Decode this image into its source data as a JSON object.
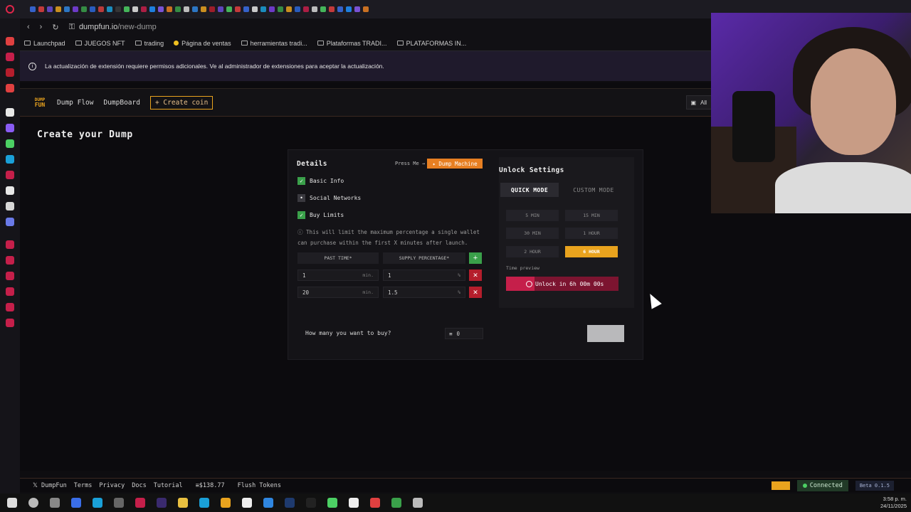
{
  "browser": {
    "url_host": "dumpfun.io",
    "url_path": "/new-dump",
    "tab_colors": [
      "#3a6ee8",
      "#e04040",
      "#6a4cd8",
      "#e9a31e",
      "#2f86e0",
      "#7b3fe4",
      "#3aa04a",
      "#2b67d9",
      "#d54040",
      "#1aa0d8",
      "#3a3a3a",
      "#4cd064",
      "#e8e8e8",
      "#c51f4a",
      "#1e90ff",
      "#8a5cf5",
      "#e77f22",
      "#3aa04a",
      "#d8d8d8",
      "#2f86e0",
      "#e9a31e",
      "#b51e2c",
      "#6a4cd8",
      "#4cd064",
      "#e04040",
      "#3a6ee8",
      "#e8e8e8",
      "#1aa0d8",
      "#7b3fe4",
      "#3aa04a",
      "#e9a31e",
      "#2b67d9",
      "#c51f4a",
      "#d8d8d8",
      "#4cd064",
      "#e04040",
      "#3a6ee8",
      "#1e90ff",
      "#8a5cf5",
      "#e77f22"
    ]
  },
  "bookmarks": [
    {
      "label": "Launchpad",
      "icon": "launchpad-icon"
    },
    {
      "label": "JUEGOS NFT",
      "icon": "folder-icon"
    },
    {
      "label": "trading",
      "icon": "folder-icon"
    },
    {
      "label": "Página de ventas",
      "icon": "dot-icon"
    },
    {
      "label": "herramientas tradi...",
      "icon": "folder-icon"
    },
    {
      "label": "Plataformas TRADI...",
      "icon": "folder-icon"
    },
    {
      "label": "PLATAFORMAS IN...",
      "icon": "folder-icon"
    }
  ],
  "notice": {
    "text": "La actualización de extensión requiere permisos adicionales. Ve al administrador de extensiones para aceptar la actualización."
  },
  "navbar": {
    "logo_top": "DUMP",
    "logo_bottom": "FUN",
    "dump_flow": "Dump Flow",
    "dumpboard": "DumpBoard",
    "create_coin": "+ Create coin",
    "right_button": "All"
  },
  "page": {
    "title": "Create your Dump"
  },
  "details": {
    "title": "Details",
    "press_me": "Press Me →",
    "dump_machine": "✦ Dump Machine",
    "checks": [
      {
        "label": "Basic Info",
        "checked": true
      },
      {
        "label": "Social Networks",
        "checked": false
      },
      {
        "label": "Buy Limits",
        "checked": true
      }
    ],
    "limit_note": "ⓘ This will limit the maximum percentage a single wallet can purchase within the first X minutes after launch.",
    "col_past_time": "PAST TIME*",
    "col_supply": "SUPPLY PERCENTAGE*",
    "add_symbol": "+",
    "rows": [
      {
        "time": "1",
        "time_unit": "min.",
        "supply": "1",
        "supply_unit": "%"
      },
      {
        "time": "20",
        "time_unit": "min.",
        "supply": "1.5",
        "supply_unit": "%"
      }
    ],
    "delete_symbol": "✕"
  },
  "unlock": {
    "title": "Unlock Settings",
    "quick_mode": "QUICK MODE",
    "custom_mode": "CUSTOM MODE",
    "times": [
      "5 MIN",
      "15 MIN",
      "30 MIN",
      "1 HOUR",
      "2 HOUR",
      "6 HOUR"
    ],
    "selected": "6 HOUR",
    "preview_label": "Time preview",
    "preview_text": "Unlock in 6h 00m 00s",
    "preview_progress": 0.25
  },
  "buy": {
    "label": "How many you want to buy?",
    "value": "0",
    "value_icon": "≡"
  },
  "footer": {
    "brand": "𝕏 DumpFun",
    "terms": "Terms",
    "privacy": "Privacy",
    "docs": "Docs",
    "tutorial": "Tutorial",
    "balance": "≡$138.77",
    "flush": "Flush Tokens",
    "connected": "Connected",
    "beta": "Beta 0.1.5"
  },
  "taskbar": {
    "time": "3:58 p. m.",
    "date": "24/11/2025"
  },
  "colors": {
    "accent_orange": "#e9a31e",
    "green": "#3aa04a",
    "red": "#b51e2c",
    "unlock_pink": "#c51f4a"
  }
}
